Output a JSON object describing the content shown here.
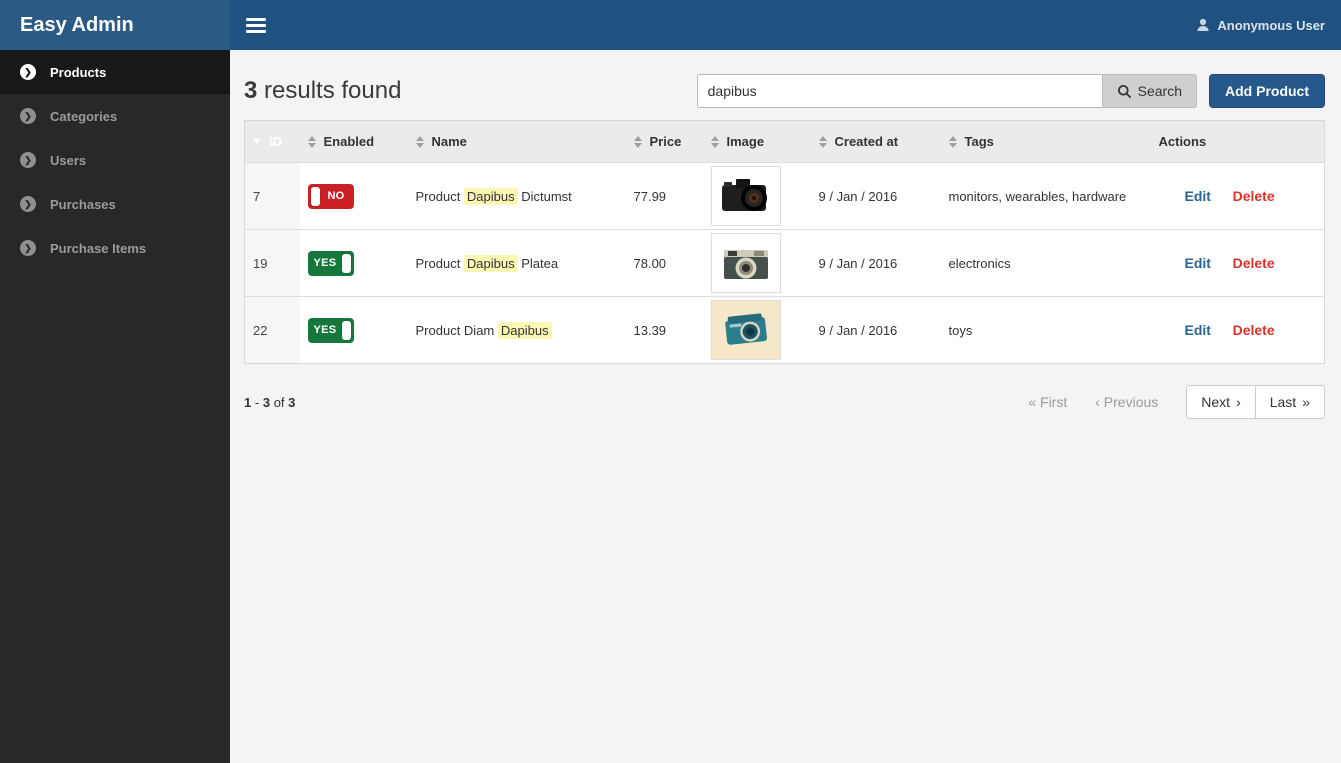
{
  "brand": {
    "title": "Easy Admin"
  },
  "topbar": {
    "user_label": "Anonymous User"
  },
  "icons": {
    "menu": "hamburger-icon",
    "user": "user-icon",
    "search": "magnifier-icon",
    "sidebar_bullet": "chevron-circle-right-icon",
    "sort": "sort-carets-icon",
    "sorted_desc": "caret-down-icon"
  },
  "colors": {
    "topbar": "#1f5181",
    "brand_bg": "#2b5b85",
    "sidebar": "#282828",
    "sidebar_active": "#181818",
    "sorted_header": "#1f5d99",
    "badge_yes": "#16763c",
    "badge_no": "#ca2026",
    "highlight": "#fbf7b4",
    "add_button": "#26588c",
    "edit_link": "#2a6395",
    "delete_link": "#d9342b"
  },
  "sidebar": {
    "items": [
      {
        "label": "Products",
        "active": true
      },
      {
        "label": "Categories",
        "active": false
      },
      {
        "label": "Users",
        "active": false
      },
      {
        "label": "Purchases",
        "active": false
      },
      {
        "label": "Purchase Items",
        "active": false
      }
    ]
  },
  "content": {
    "results_count": "3",
    "results_text": " results found",
    "search": {
      "value": "dapibus",
      "button_label": "Search"
    },
    "add_button_label": "Add Product",
    "table": {
      "columns": [
        "ID",
        "Enabled",
        "Name",
        "Price",
        "Image",
        "Created at",
        "Tags",
        "Actions"
      ],
      "rows": [
        {
          "id": "7",
          "enabled_label": "NO",
          "enabled_state": "no",
          "name_pre": "Product ",
          "name_match": "Dapibus",
          "name_post": " Dictumst",
          "price": "77.99",
          "image_alt": "black DSLR camera",
          "created_at": "9 / Jan / 2016",
          "tags": "monitors, wearables, hardware",
          "edit_label": "Edit",
          "delete_label": "Delete"
        },
        {
          "id": "19",
          "enabled_label": "YES",
          "enabled_state": "yes",
          "name_pre": "Product ",
          "name_match": "Dapibus",
          "name_post": " Platea",
          "price": "78.00",
          "image_alt": "vintage gray camera",
          "created_at": "9 / Jan / 2016",
          "tags": "electronics",
          "edit_label": "Edit",
          "delete_label": "Delete"
        },
        {
          "id": "22",
          "enabled_label": "YES",
          "enabled_state": "yes",
          "name_pre": "Product Diam ",
          "name_match": "Dapibus",
          "name_post": "",
          "price": "13.39",
          "image_alt": "teal compact camera",
          "created_at": "9 / Jan / 2016",
          "tags": "toys",
          "edit_label": "Edit",
          "delete_label": "Delete"
        }
      ]
    },
    "pagination": {
      "range_start": "1",
      "range_dash": "-",
      "range_end": "3",
      "of_text": "of",
      "total": "3",
      "first_glyph": "«",
      "first_label": "First",
      "previous_glyph": "‹",
      "previous_label": "Previous",
      "next_label": "Next",
      "next_glyph": "›",
      "last_label": "Last",
      "last_glyph": "»"
    }
  }
}
